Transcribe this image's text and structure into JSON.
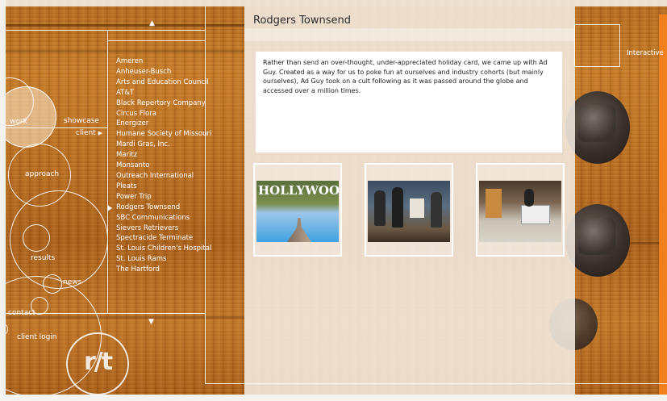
{
  "nav": {
    "work": "work",
    "showcase": "showcase",
    "client": "client",
    "approach": "approach",
    "results": "results",
    "news": "news",
    "contact": "contact",
    "client_login": "client login"
  },
  "logo": {
    "text": "r/t"
  },
  "clients": [
    "Ameren",
    "Anheuser-Busch",
    "Arts and Education Council",
    "AT&T",
    "Black Repertory Company",
    "Circus Flora",
    "Energizer",
    "Humane Society of Missouri",
    "Mardi Gras, Inc.",
    "Maritz",
    "Monsanto",
    "Outreach International",
    "Pleats",
    "Power Trip",
    "Rodgers Townsend",
    "SBC Communications",
    "Sievers Retrievers",
    "Spectracide Terminate",
    "St. Louis Children's Hospital",
    "St. Louis Rams",
    "The Hartford"
  ],
  "active_client": "Rodgers Townsend",
  "panel": {
    "title": "Rodgers Townsend",
    "description": "Rather than send an over-thought, under-appreciated holiday card, we came up with Ad Guy. Created as a way for us to poke fun at ourselves and industry cohorts (but mainly ourselves), Ad Guy took on a cult following as it was passed around the globe and accessed over a million times.",
    "thumbnails": [
      {
        "alt": "hollywood-sign-thumbnail",
        "sign_text": "HOLLYWOO"
      },
      {
        "alt": "ad-guy-characters-thumbnail"
      },
      {
        "alt": "ad-guy-office-thumbnail"
      }
    ]
  },
  "right": {
    "interactive": "Interactive"
  },
  "colors": {
    "wood": "#b26a1f",
    "panel": "#f4ece2",
    "line": "#ffffff"
  }
}
